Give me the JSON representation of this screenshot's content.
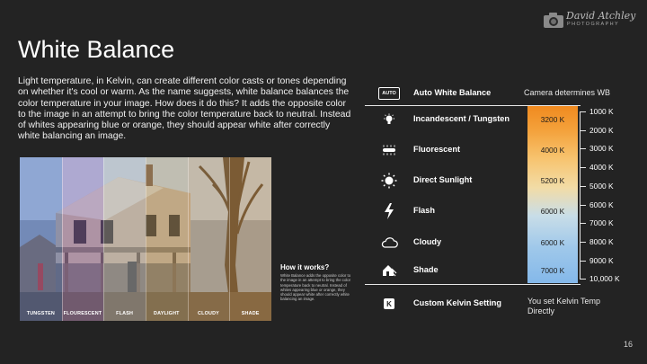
{
  "logo": {
    "script": "David Atchley",
    "sub": "PHOTOGRAPHY"
  },
  "slide": {
    "title": "White Balance",
    "paragraph": "Light temperature, in Kelvin, can create different color casts or tones depending on whether it's cool or warm. As the name suggests, white balance balances the color temperature in your image. How does it do this? It adds the opposite color to the image in an attempt to bring the color temperature back to neutral. Instead of whites appearing blue or orange, they should appear white after correctly white balancing an image.",
    "page_number": "16"
  },
  "photo": {
    "bands": [
      {
        "label": "TUNGSTEN",
        "tint": "#3a6bd6"
      },
      {
        "label": "FLOURESCENT",
        "tint": "#9a6fd0"
      },
      {
        "label": "FLASH",
        "tint": "#c9c9c9"
      },
      {
        "label": "DAYLIGHT",
        "tint": "#d4b070"
      },
      {
        "label": "CLOUDY",
        "tint": "#dca55a"
      },
      {
        "label": "SHADE",
        "tint": "#e3a048"
      }
    ]
  },
  "how": {
    "title": "How it works?",
    "body": "White Balance adds the opposite color to the image in an attempt to bring the color temperature back to neutral. Instead of whites appearing blue or orange, they should appear white after correctly white balancing an image."
  },
  "wb": {
    "auto": {
      "icon_text": "AUTO",
      "label": "Auto White Balance",
      "note": "Camera determines WB"
    },
    "presets": [
      {
        "label": "Incandescent / Tungsten",
        "icon": "bulb-icon",
        "kelvin": "3200 K"
      },
      {
        "label": "Fluorescent",
        "icon": "fluorescent-icon",
        "kelvin": "4000 K"
      },
      {
        "label": "Direct Sunlight",
        "icon": "sun-icon",
        "kelvin": "5200 K"
      },
      {
        "label": "Flash",
        "icon": "flash-icon",
        "kelvin": "6000 K"
      },
      {
        "label": "Cloudy",
        "icon": "cloud-icon",
        "kelvin": "6000 K"
      },
      {
        "label": "Shade",
        "icon": "shade-icon",
        "kelvin": "7000 K"
      }
    ],
    "custom": {
      "icon_text": "K",
      "label": "Custom Kelvin Setting",
      "note": "You set Kelvin Temp Directly"
    },
    "scale": [
      "1000 K",
      "2000 K",
      "3000 K",
      "4000 K",
      "5000 K",
      "6000 K",
      "7000 K",
      "8000 K",
      "9000 K",
      "10,000 K"
    ]
  }
}
